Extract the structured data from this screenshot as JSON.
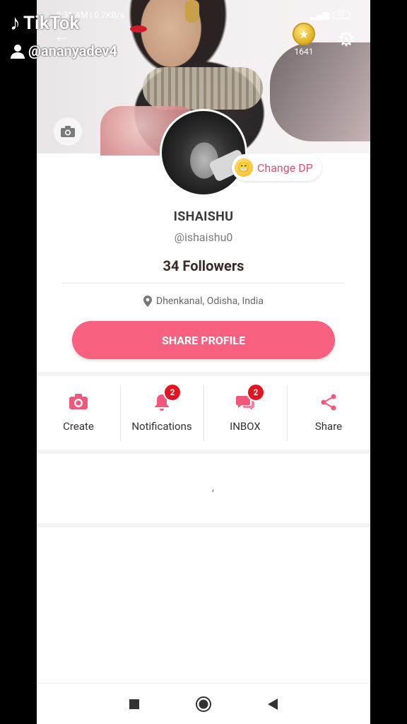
{
  "overlay": {
    "app_watermark": "TikTok",
    "user_watermark": "@ananyadev4"
  },
  "statusbar": {
    "time": "9:31 AM | 0.2KB/s",
    "battery": "49"
  },
  "header": {
    "coins": "1641"
  },
  "profile": {
    "change_dp_label": "Change DP",
    "name": "ISHAISHU",
    "handle": "@ishaishu0",
    "followers": "34 Followers",
    "location": "Dhenkanal, Odisha, India",
    "share_profile_label": "SHARE PROFILE"
  },
  "actions": [
    {
      "label": "Create",
      "icon": "camera-icon",
      "badge": null
    },
    {
      "label": "Notifications",
      "icon": "bell-icon",
      "badge": "2"
    },
    {
      "label": "INBOX",
      "icon": "chat-icon",
      "badge": "2"
    },
    {
      "label": "Share",
      "icon": "share-icon",
      "badge": null
    }
  ],
  "content": {
    "glyph": ","
  },
  "colors": {
    "accent": "#f7617f",
    "badge": "#e3141f"
  }
}
